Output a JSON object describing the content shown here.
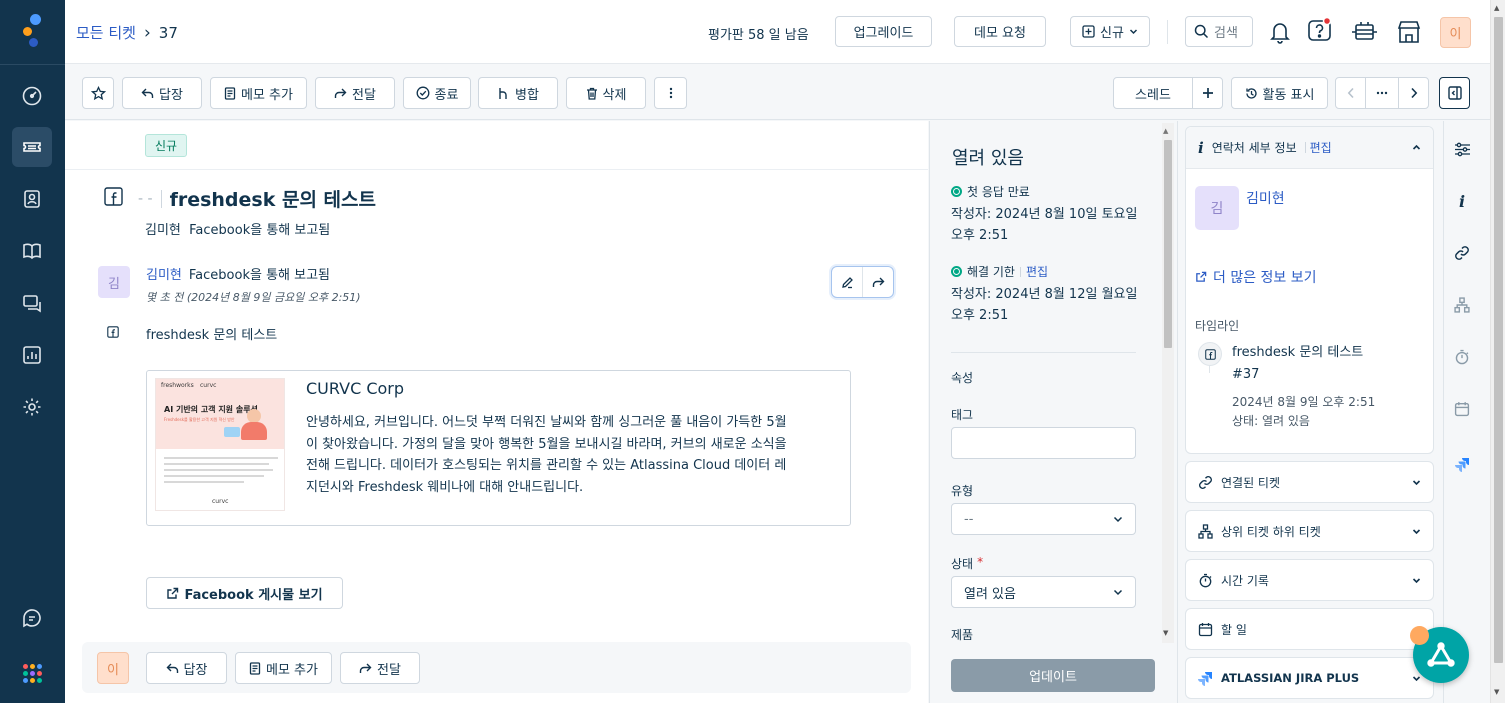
{
  "header": {
    "breadcrumb_root": "모든 티켓",
    "breadcrumb_sep": "›",
    "ticket_number": "37",
    "trial_text": "평가판 58 일 남음",
    "upgrade_label": "업그레이드",
    "demo_label": "데모 요청",
    "new_label": "신규",
    "search_label": "검색",
    "avatar_initial": "이"
  },
  "toolbar": {
    "reply": "답장",
    "add_note": "메모 추가",
    "forward": "전달",
    "close": "종료",
    "merge": "병합",
    "delete": "삭제",
    "thread": "스레드",
    "activity": "활동 표시"
  },
  "ticket": {
    "status_badge": "신규",
    "subject_prefix": "- -",
    "subject": "freshdesk 문의 테스트",
    "reporter_line": "김미현  Facebook을 통해 보고됨"
  },
  "message": {
    "avatar": "김",
    "author": "김미현",
    "via": "Facebook을 통해 보고됨",
    "time": "몇 초 전 (2024년 8월 9일 금요일 오후 2:51)",
    "body": "freshdesk 문의 테스트",
    "card_title": "CURVC Corp",
    "card_text": "안녕하세요, 커브입니다. 어느덧 부쩍 더워진 날씨와 함께 싱그러운 풀 내음이 가득한 5월이 찾아왔습니다. 가정의 달을 맞아 행복한 5월을 보내시길 바라며, 커브의 새로운 소식을 전해 드립니다. 데이터가 호스팅되는 위치를 관리할 수 있는 Atlassina Cloud 데이터 레지던시와 Freshdesk 웨비나에 대해 안내드립니다.",
    "thumb_brand1": "freshworks",
    "thumb_brand2": "curvc",
    "thumb_title": "AI 기반의 고객 지원 솔루션",
    "thumb_sub": "Freshdesk를 활용한 고객 지원 혁신 방안",
    "thumb_footer": "curvc",
    "view_post": "Facebook 게시물 보기"
  },
  "bottom_bar": {
    "avatar": "이",
    "reply": "답장",
    "add_note": "메모 추가",
    "forward": "전달"
  },
  "properties": {
    "status_title": "열려 있음",
    "first_response_label": "첫 응답 만료",
    "first_response_date": "작성자: 2024년 8월 10일 토요일 오후 2:51",
    "resolution_label": "해결 기한",
    "resolution_edit": "편집",
    "resolution_date": "작성자: 2024년 8월 12일 월요일 오후 2:51",
    "section_label": "속성",
    "tags_label": "태그",
    "type_label": "유형",
    "type_value": "--",
    "state_label": "상태",
    "required_mark": "*",
    "state_value": "열려 있음",
    "product_label": "제품",
    "update_button": "업데이트"
  },
  "contact": {
    "title": "연락처 세부 정보",
    "edit": "편집",
    "avatar": "김",
    "name": "김미현",
    "more_info": "더 많은 정보 보기",
    "timeline_label": "타임라인",
    "timeline_title": "freshdesk 문의 테스트",
    "timeline_number": "#37",
    "timeline_date": "2024년 8월 9일 오후 2:51",
    "timeline_status": "상태: 열려 있음"
  },
  "accordions": {
    "linked": "연결된 티켓",
    "parent_child": "상위 티켓 하위 티켓",
    "time_log": "시간 기록",
    "todo": "할 일",
    "jira": "ATLASSIAN JIRA PLUS"
  },
  "colors": {
    "sidebar": "#12344d",
    "accent": "#2c5cc5",
    "green": "#00a886",
    "avatar_peach": "#ffdfcc",
    "fab": "#00a4a6"
  }
}
